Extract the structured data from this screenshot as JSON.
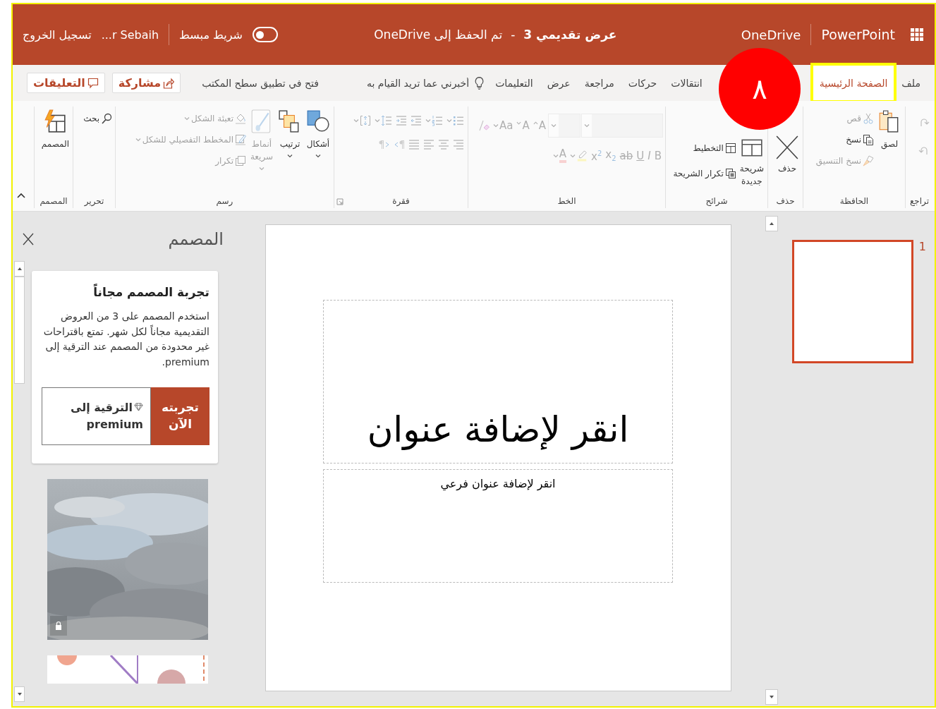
{
  "title_bar": {
    "app_name": "PowerPoint",
    "service": "OneDrive",
    "document_title": "عرض تقديمي 3",
    "title_separator": "-",
    "save_status": "تم الحفظ إلى OneDrive",
    "simplified_ribbon": {
      "label": "شريط مبسط",
      "on": false
    },
    "user_name": "...r Sebaih",
    "sign_out": "تسجيل الخروج"
  },
  "tabs": [
    {
      "label": "ملف",
      "selected": false,
      "highlighted": false
    },
    {
      "label": "الصفحة الرئيسية",
      "selected": true,
      "highlighted": true
    },
    {
      "label": "انتقالات",
      "selected": false,
      "highlighted": false
    },
    {
      "label": "حركات",
      "selected": false,
      "highlighted": false
    },
    {
      "label": "مراجعة",
      "selected": false,
      "highlighted": false
    },
    {
      "label": "عرض",
      "selected": false,
      "highlighted": false
    },
    {
      "label": "التعليمات",
      "selected": false,
      "highlighted": false
    }
  ],
  "tell_me": {
    "placeholder": "أخبرني عما تريد القيام به"
  },
  "open_in_desktop": "فتح في تطبيق سطح المكتب",
  "share_button": "مشاركة",
  "comments_button": "التعليقات",
  "ribbon": {
    "groups": [
      {
        "label": "تراجع",
        "launcher": false,
        "items": [
          {
            "kind": "redo",
            "disabled": true,
            "dropdown": false
          },
          {
            "kind": "undo",
            "disabled": true,
            "dropdown": false
          }
        ]
      },
      {
        "label": "الحافظة",
        "launcher": false,
        "items": [
          {
            "kind": "paste",
            "label": "لصق",
            "disabled": false,
            "dropdown": false
          },
          {
            "kind": "cut",
            "label": "قص",
            "disabled": true,
            "dropdown": false
          },
          {
            "kind": "copy",
            "label": "نسخ",
            "disabled": false,
            "dropdown": false
          },
          {
            "kind": "format-painter",
            "label": "نسخ التنسيق",
            "disabled": true,
            "dropdown": false
          }
        ]
      },
      {
        "label": "حذف",
        "launcher": false,
        "items": [
          {
            "kind": "delete",
            "label": "حذف",
            "disabled": false,
            "dropdown": false
          }
        ]
      },
      {
        "label": "شرائح",
        "launcher": false,
        "items": [
          {
            "kind": "new-slide",
            "label": "شريحة جديدة",
            "disabled": false,
            "dropdown": false
          },
          {
            "kind": "layout",
            "label": "التخطيط",
            "disabled": false,
            "dropdown": false
          },
          {
            "kind": "duplicate-slide",
            "label": "تكرار الشريحة",
            "disabled": false,
            "dropdown": false
          }
        ]
      },
      {
        "label": "الخط",
        "launcher": false,
        "rows": [
          [
            {
              "kind": "font-name",
              "disabled": true,
              "dropdown": true
            },
            {
              "kind": "font-size",
              "disabled": true,
              "dropdown": true
            },
            {
              "kind": "grow",
              "glyph": "A",
              "disabled": true,
              "dropdown": false
            },
            {
              "kind": "shrink",
              "glyph": "A",
              "disabled": true,
              "dropdown": false
            },
            {
              "kind": "change-case",
              "glyph": "Aa",
              "disabled": true,
              "dropdown": true
            },
            {
              "kind": "clear-format",
              "disabled": true,
              "dropdown": false
            }
          ],
          [
            {
              "kind": "bold",
              "glyph": "B",
              "disabled": true,
              "dropdown": false
            },
            {
              "kind": "italic",
              "glyph": "I",
              "disabled": true,
              "dropdown": false
            },
            {
              "kind": "underline",
              "glyph": "U",
              "disabled": true,
              "dropdown": false
            },
            {
              "kind": "strikethrough",
              "glyph": "ab",
              "disabled": true,
              "dropdown": false
            },
            {
              "kind": "subscript",
              "glyph": "x$_{2}$",
              "disabled": true,
              "dropdown": false
            },
            {
              "kind": "superscript",
              "glyph": "x$^{2}$",
              "disabled": true,
              "dropdown": false
            },
            {
              "kind": "highlight",
              "disabled": true,
              "dropdown": true
            },
            {
              "kind": "font-color",
              "glyph": "A",
              "disabled": true,
              "dropdown": true
            }
          ]
        ]
      },
      {
        "label": "فقرة",
        "launcher": true,
        "rows": [
          [
            {
              "kind": "bullets",
              "disabled": true,
              "dropdown": true
            },
            {
              "kind": "numbering",
              "disabled": true,
              "dropdown": true
            },
            {
              "kind": "decrease-indent",
              "disabled": true,
              "dropdown": false
            },
            {
              "kind": "increase-indent",
              "disabled": true,
              "dropdown": false
            },
            {
              "kind": "line-spacing",
              "disabled": true,
              "dropdown": true
            },
            {
              "kind": "align-text",
              "disabled": true,
              "dropdown": true
            }
          ],
          [
            {
              "kind": "align-right",
              "disabled": true,
              "dropdown": false
            },
            {
              "kind": "align-center",
              "disabled": true,
              "dropdown": false
            },
            {
              "kind": "align-left",
              "disabled": true,
              "dropdown": false
            },
            {
              "kind": "justify",
              "disabled": true,
              "dropdown": false
            },
            {
              "kind": "rtl",
              "disabled": true,
              "dropdown": false
            },
            {
              "kind": "ltr",
              "disabled": true,
              "dropdown": false
            }
          ]
        ]
      },
      {
        "label": "رسم",
        "launcher": false,
        "items": [
          {
            "kind": "shapes",
            "label": "أشكال",
            "disabled": false,
            "dropdown": true
          },
          {
            "kind": "arrange",
            "label": "ترتيب",
            "disabled": false,
            "dropdown": true
          },
          {
            "kind": "quick-styles",
            "label": "أنماط سريعة",
            "disabled": true,
            "dropdown": true
          },
          {
            "kind": "shape-fill",
            "label": "تعبئة الشكل",
            "disabled": true,
            "dropdown": true
          },
          {
            "kind": "shape-outline",
            "label": "المخطط التفصيلي للشكل",
            "disabled": true,
            "dropdown": true
          },
          {
            "kind": "duplicate",
            "label": "تكرار",
            "disabled": true,
            "dropdown": false
          }
        ]
      },
      {
        "label": "تحرير",
        "launcher": false,
        "items": [
          {
            "kind": "find",
            "label": "بحث",
            "disabled": false,
            "dropdown": false
          }
        ]
      },
      {
        "label": "المصمم",
        "launcher": false,
        "items": [
          {
            "kind": "designer",
            "label": "المصمم",
            "disabled": false,
            "dropdown": false
          }
        ]
      }
    ]
  },
  "slides": [
    {
      "number": "1",
      "selected": true
    }
  ],
  "slide": {
    "title_placeholder": "انقر لإضافة عنوان",
    "subtitle_placeholder": "انقر لإضافة عنوان فرعي"
  },
  "designer": {
    "title": "المصمم",
    "promo": {
      "heading": "تجربة المصمم مجاناً",
      "body": "استخدم المصمم على 3 من العروض التقديمية مجاناً لكل شهر. تمتع باقتراحات غير محدودة من المصمم عند الترقية إلى premium.",
      "try_button": "تجربته الآن",
      "upgrade_button": "الترقية إلى premium"
    },
    "designs": [
      {
        "kind": "picture",
        "premium": true
      },
      {
        "kind": "picture",
        "premium": false
      }
    ]
  },
  "annotation": {
    "step_badge": "٨"
  }
}
